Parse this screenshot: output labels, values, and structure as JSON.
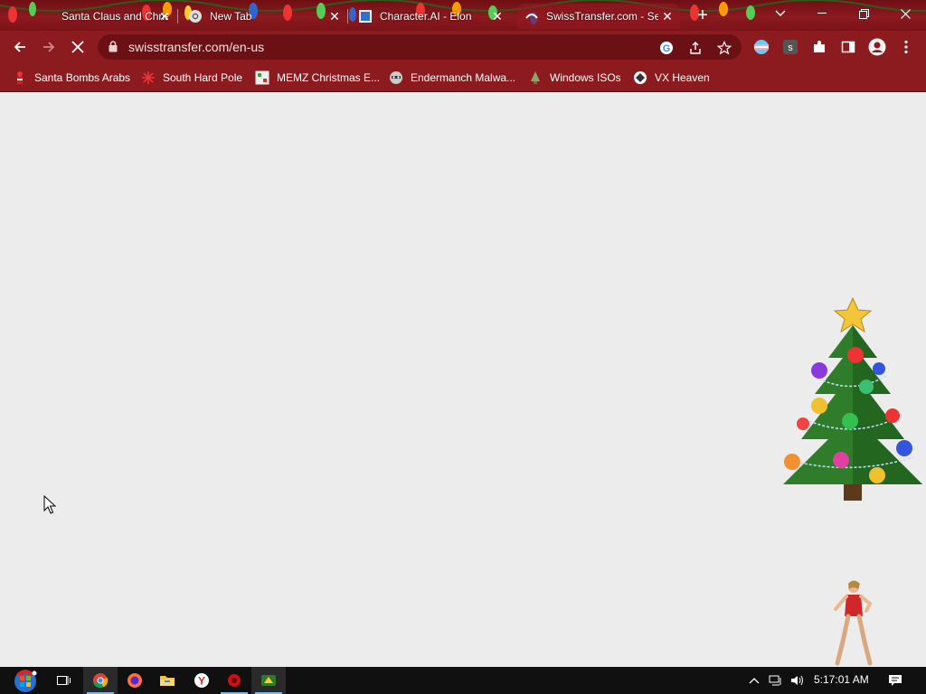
{
  "colors": {
    "frame_dark": "#6e0f14",
    "frame": "#8c1b20",
    "omnibox_bg": "#6b1015",
    "page_bg": "#ececec",
    "taskbar_bg": "#101010"
  },
  "tabs": [
    {
      "title": "Santa Claus and Christ",
      "favicon": "santa-icon",
      "active": false
    },
    {
      "title": "New Tab",
      "favicon": "chrome-icon",
      "active": false
    },
    {
      "title": "Character.AI - Elon",
      "favicon": "character-ai-icon",
      "active": false
    },
    {
      "title": "SwissTransfer.com - Se",
      "favicon": "loading-icon",
      "active": true
    }
  ],
  "tab_close_glyph": "✕",
  "new_tab_glyph": "+",
  "window_controls": {
    "tab_search": "⌄",
    "minimize": "—",
    "restore": "❐",
    "close": "✕"
  },
  "toolbar": {
    "back_icon": "back-arrow-icon",
    "forward_icon": "forward-arrow-icon",
    "stop_icon": "stop-icon",
    "url": "swisstransfer.com/en-us"
  },
  "bookmarks": [
    {
      "label": "Santa Bombs Arabs",
      "icon": "santa-figure-icon"
    },
    {
      "label": "South Hard Pole",
      "icon": "snowflake-icon"
    },
    {
      "label": "MEMZ Christmas E...",
      "icon": "memz-icon"
    },
    {
      "label": "Endermanch Malwa...",
      "icon": "raccoon-icon"
    },
    {
      "label": "Windows ISOs",
      "icon": "tree-figure-icon"
    },
    {
      "label": "VX Heaven",
      "icon": "vx-heaven-icon"
    }
  ],
  "taskbar": {
    "clock": "5:17:01 AM",
    "apps": [
      "start-orb-icon",
      "task-view-icon",
      "chrome-icon",
      "firefox-icon",
      "file-explorer-icon",
      "yandex-icon",
      "red-app-icon",
      "green-app-icon"
    ]
  }
}
